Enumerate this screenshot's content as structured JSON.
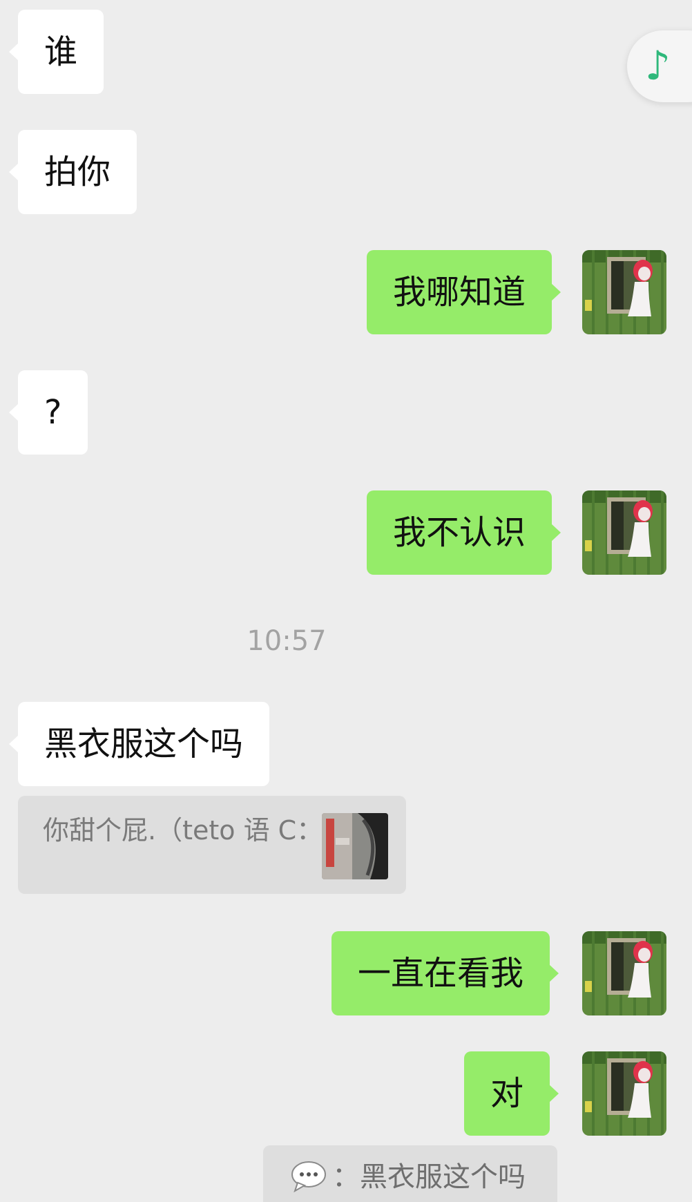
{
  "messages": {
    "m1": "谁",
    "m2": "拍你",
    "m3": "我哪知道",
    "m4": "?",
    "m5": "我不认识",
    "m6": "黑衣服这个吗",
    "m7": "一直在看我",
    "m8": "对"
  },
  "timestamp": "10:57",
  "quotes": {
    "q1": "你甜个屁.（teto 语 C：",
    "q2": "：黑衣服这个吗"
  },
  "icons": {
    "music": "music-note-icon",
    "chat_emoji": "chat-bubble-emoji-icon"
  },
  "colors": {
    "background": "#ededed",
    "incoming_bubble": "#ffffff",
    "outgoing_bubble": "#95ec69",
    "quote_bubble": "#dedede",
    "timestamp": "#a3a3a3",
    "music_icon": "#2fb87b"
  }
}
